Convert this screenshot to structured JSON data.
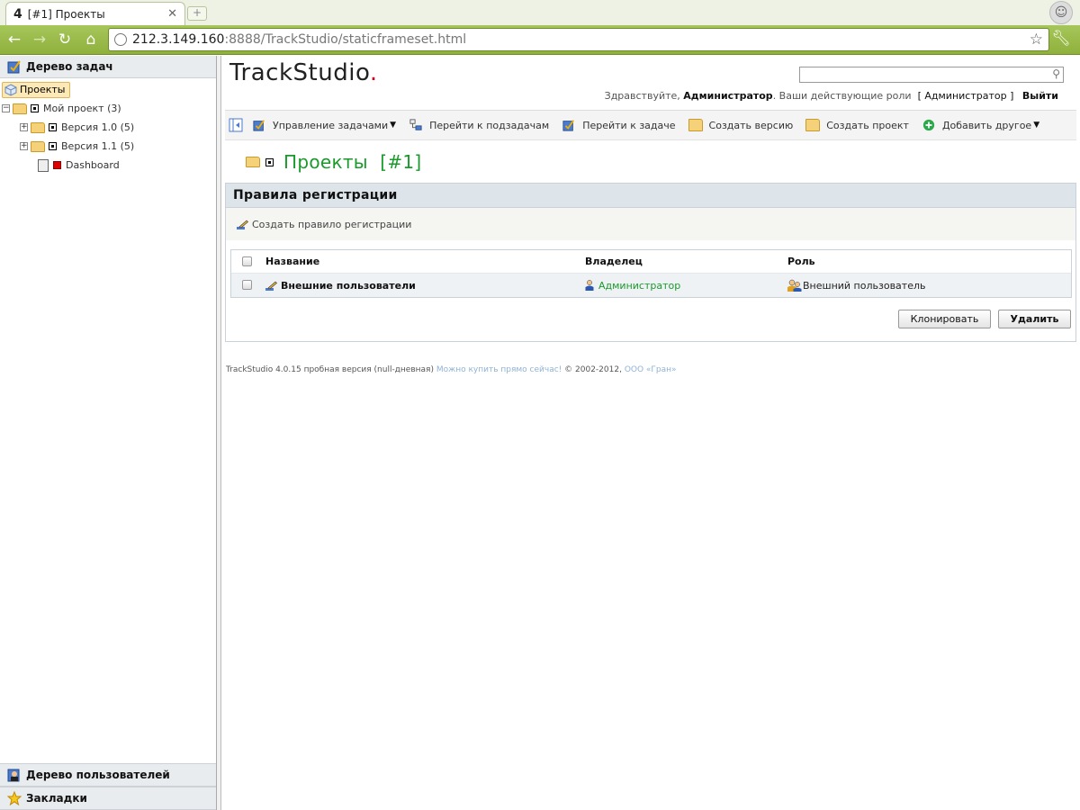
{
  "browser": {
    "tab_title": "[#1] Проекты",
    "tab_icon": "4",
    "url_host": "212.3.149.160",
    "url_rest": ":8888/TrackStudio/staticframeset.html"
  },
  "left": {
    "task_tree_header": "Дерево задач",
    "tree": {
      "root": "Проекты",
      "project": "Мой проект (3)",
      "version1": "Версия 1.0 (5)",
      "version2": "Версия 1.1 (5)",
      "dashboard": "Dashboard"
    },
    "users_tree_header": "Дерево пользователей",
    "bookmarks_header": "Закладки"
  },
  "header": {
    "logo": "TrackStudio",
    "logo_dot": ".",
    "greeting_prefix": "Здравствуйте,",
    "user": "Администратор",
    "roles_text": ". Ваши действующие роли",
    "role_bracket": "[ Администратор ]",
    "logout": "Выйти"
  },
  "actions": {
    "manage": "Управление задачами",
    "subtasks": "Перейти к подзадачам",
    "goto_task": "Перейти к задаче",
    "create_version": "Создать версию",
    "create_project": "Создать проект",
    "add_other": "Добавить другое"
  },
  "page": {
    "title": "Проекты",
    "task_number": "[#1]"
  },
  "rules": {
    "header": "Правила регистрации",
    "create_link": "Создать правило регистрации",
    "columns": [
      "Название",
      "Владелец",
      "Роль"
    ],
    "rows": [
      {
        "name": "Внешние пользователи",
        "owner": "Администратор",
        "role": "Внешний пользователь"
      }
    ],
    "clone_button": "Клонировать",
    "delete_button": "Удалить"
  },
  "footer": {
    "text": "TrackStudio 4.0.15 пробная версия (null-дневная)",
    "buy_link": "Можно купить прямо сейчас!",
    "copyright": "© 2002-2012,",
    "company_link": "ООО «Гран»"
  },
  "colors": {
    "accent_green": "#1a9a2a",
    "chrome_green": "#9bbd4b",
    "header_bg": "#dde5ea"
  }
}
